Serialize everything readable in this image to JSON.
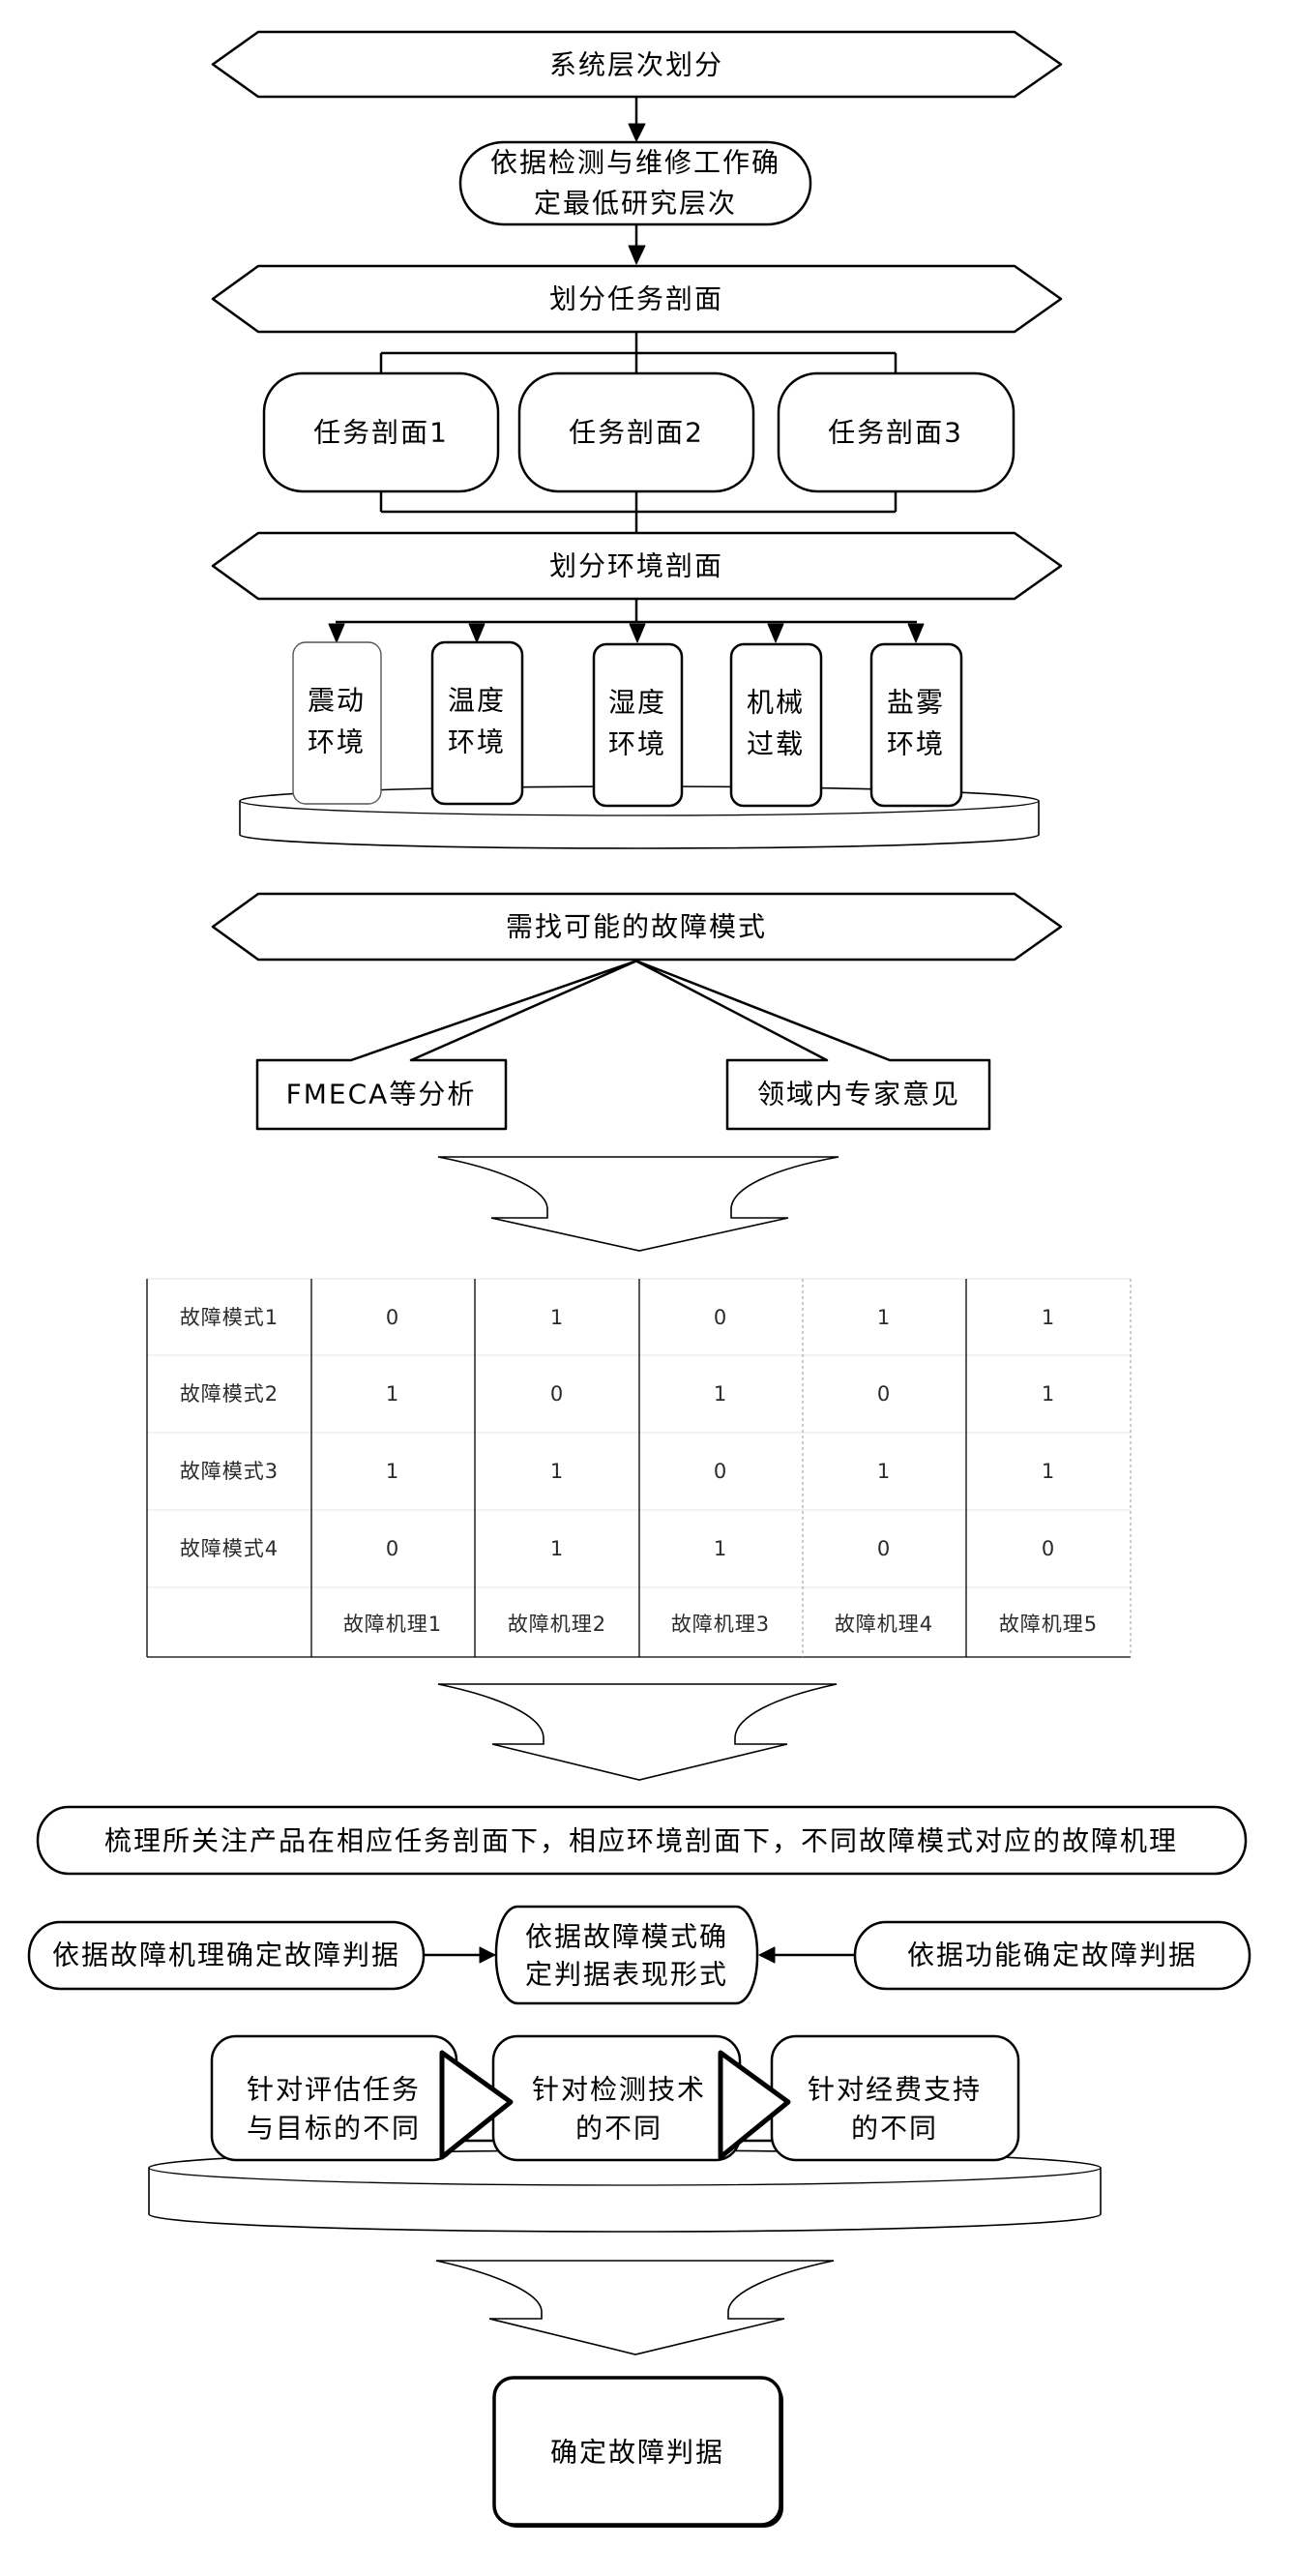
{
  "flow": {
    "system_level": "系统层次划分",
    "lowest_level": {
      "line1": "依据检测与维修工作确",
      "line2": "定最低研究层次"
    },
    "mission_profile_step": "划分任务剖面",
    "mission_profiles": [
      "任务剖面1",
      "任务剖面2",
      "任务剖面3"
    ],
    "environment_profile_step": "划分环境剖面",
    "environments": [
      {
        "line1": "震动",
        "line2": "环境"
      },
      {
        "line1": "温度",
        "line2": "环境"
      },
      {
        "line1": "湿度",
        "line2": "环境"
      },
      {
        "line1": "机械",
        "line2": "过载"
      },
      {
        "line1": "盐雾",
        "line2": "环境"
      }
    ],
    "fault_mode_step": "需找可能的故障模式",
    "fault_mode_sources": [
      "FMECA等分析",
      "领域内专家意见"
    ],
    "mechanism_step": "梳理所关注产品在相应任务剖面下，相应环境剖面下，不同故障模式对应的故障机理",
    "criteria": {
      "left": "依据故障机理确定故障判据",
      "center": {
        "line1": "依据故障模式确",
        "line2": "定判据表现形式"
      },
      "right": "依据功能确定故障判据"
    },
    "considerations": [
      {
        "line1": "针对评估任务",
        "line2": "与目标的不同"
      },
      {
        "line1": "针对检测技术",
        "line2": "的不同"
      },
      {
        "line1": "针对经费支持",
        "line2": "的不同"
      }
    ],
    "result": "确定故障判据"
  },
  "matrix": {
    "row_labels": [
      "故障模式1",
      "故障模式2",
      "故障模式3",
      "故障模式4"
    ],
    "column_labels": [
      "故障机理1",
      "故障机理2",
      "故障机理3",
      "故障机理4",
      "故障机理5"
    ],
    "values": [
      [
        0,
        1,
        0,
        1,
        1
      ],
      [
        1,
        0,
        1,
        0,
        1
      ],
      [
        1,
        1,
        0,
        1,
        1
      ],
      [
        0,
        1,
        1,
        0,
        0
      ]
    ]
  },
  "colors": {
    "stroke": "#000000",
    "background": "#ffffff",
    "table_text": "#2a2a2a"
  }
}
